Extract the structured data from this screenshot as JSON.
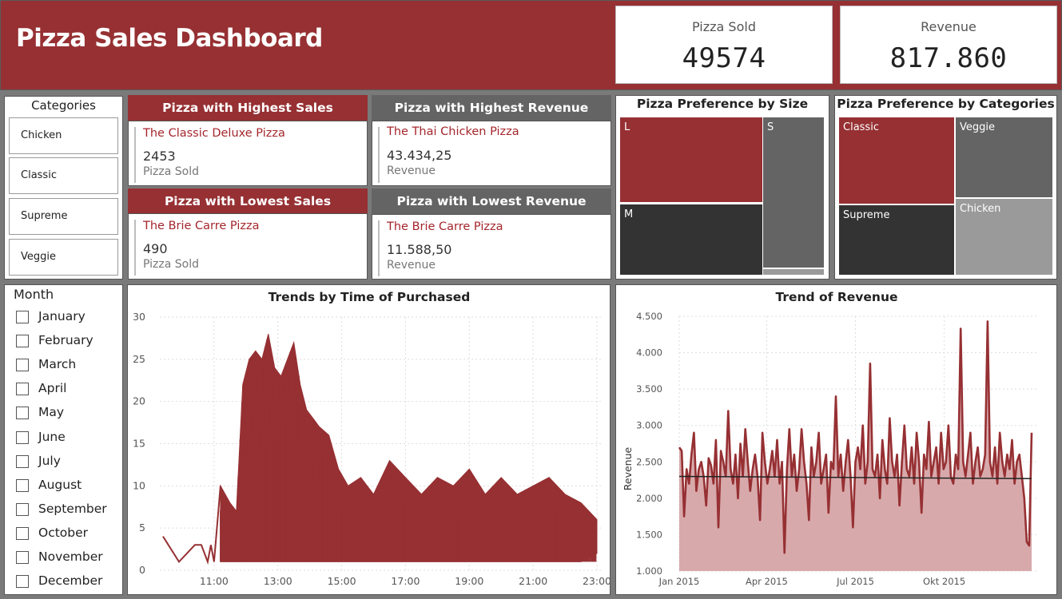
{
  "header": {
    "title": "Pizza Sales Dashboard"
  },
  "kpis": {
    "pizza_sold": {
      "label": "Pizza Sold",
      "value": "49574"
    },
    "revenue": {
      "label": "Revenue",
      "value": "817.860"
    }
  },
  "categories_slicer": {
    "title": "Categories",
    "items": [
      "Chicken",
      "Classic",
      "Supreme",
      "Veggie"
    ]
  },
  "cards": {
    "highest_sales": {
      "title": "Pizza with Highest Sales",
      "name": "The Classic Deluxe Pizza",
      "value": "2453",
      "sub": "Pizza Sold"
    },
    "highest_revenue": {
      "title": "Pizza with Highest Revenue",
      "name": "The Thai Chicken Pizza",
      "value": "43.434,25",
      "sub": "Revenue"
    },
    "lowest_sales": {
      "title": "Pizza with Lowest Sales",
      "name": "The Brie Carre Pizza",
      "value": "490",
      "sub": "Pizza Sold"
    },
    "lowest_revenue": {
      "title": "Pizza with Lowest Revenue",
      "name": "The Brie Carre Pizza",
      "value": "11.588,50",
      "sub": "Revenue"
    }
  },
  "size_treemap": {
    "title": "Pizza Preference by Size",
    "tiles": {
      "L": "L",
      "M": "M",
      "S": "S"
    }
  },
  "category_treemap": {
    "title": "Pizza Preference by Categories",
    "tiles": {
      "classic": "Classic",
      "veggie": "Veggie",
      "supreme": "Supreme",
      "chicken": "Chicken"
    }
  },
  "month_slicer": {
    "title": "Month",
    "items": [
      "January",
      "February",
      "March",
      "April",
      "May",
      "June",
      "July",
      "August",
      "September",
      "October",
      "November",
      "December"
    ]
  },
  "colors": {
    "brand_red": "#963033",
    "dark": "#333333",
    "gray": "#646464",
    "light_gray": "#9a9a9a",
    "area_fill": "#d8a9ab"
  },
  "chart_data": [
    {
      "id": "time_trend",
      "type": "line",
      "title": "Trends by Time of Purchased",
      "xlabel": "",
      "ylabel": "",
      "x_ticks": [
        "11:00",
        "13:00",
        "15:00",
        "17:00",
        "19:00",
        "21:00",
        "23:00"
      ],
      "x_range_hours": [
        9.3,
        23.2
      ],
      "ylim": [
        0,
        30
      ],
      "y_ticks": [
        0,
        5,
        10,
        15,
        20,
        25,
        30
      ],
      "envelope": {
        "hours": [
          9.4,
          9.9,
          10.4,
          10.6,
          10.8,
          10.9,
          11.0,
          11.2,
          11.5,
          11.7,
          11.9,
          12.1,
          12.3,
          12.5,
          12.7,
          12.9,
          13.1,
          13.3,
          13.5,
          13.7,
          13.9,
          14.1,
          14.3,
          14.6,
          14.9,
          15.2,
          15.6,
          16.0,
          16.5,
          17.0,
          17.5,
          18.0,
          18.5,
          19.0,
          19.5,
          20.0,
          20.5,
          21.0,
          21.5,
          22.0,
          22.5,
          23.0
        ],
        "max": [
          4,
          1,
          3,
          3,
          1,
          3,
          1,
          10,
          8,
          7,
          22,
          25,
          26,
          25,
          28,
          24,
          23,
          25,
          27,
          22,
          19,
          18,
          17,
          16,
          12,
          10,
          11,
          9,
          13,
          11,
          9,
          11,
          10,
          12,
          9,
          11,
          9,
          10,
          11,
          9,
          8,
          6
        ],
        "min": [
          4,
          1,
          3,
          3,
          1,
          3,
          1,
          1,
          1,
          1,
          1,
          1,
          1,
          1,
          1,
          1,
          1,
          1,
          1,
          1,
          1,
          1,
          1,
          1,
          1,
          1,
          1,
          1,
          1,
          1,
          1,
          1,
          1,
          1,
          1,
          1,
          1,
          1,
          1,
          1,
          1,
          2
        ]
      }
    },
    {
      "id": "revenue_trend",
      "type": "area",
      "title": "Trend of Revenue",
      "xlabel": "",
      "ylabel": "Revenue",
      "x_ticks": [
        "Jan 2015",
        "Apr 2015",
        "Jul 2015",
        "Okt 2015"
      ],
      "ylim": [
        1000,
        4500
      ],
      "y_ticks": [
        "1.000",
        "1.500",
        "2.000",
        "2.500",
        "3.000",
        "3.500",
        "4.000",
        "4.500"
      ],
      "trendline": {
        "start": 2300,
        "end": 2270
      },
      "series": [
        {
          "values": [
            2700,
            2650,
            1750,
            2400,
            2200,
            2600,
            2900,
            2100,
            2400,
            2500,
            2300,
            1900,
            2550,
            2450,
            2200,
            2800,
            1600,
            2650,
            2500,
            2300,
            3200,
            2400,
            2200,
            2600,
            2000,
            2750,
            2300,
            2950,
            2500,
            2100,
            2400,
            2600,
            2300,
            1700,
            2900,
            2500,
            2200,
            2400,
            2650,
            2300,
            2800,
            2200,
            2500,
            1250,
            2400,
            2950,
            2300,
            2600,
            2100,
            2400,
            2950,
            2500,
            2200,
            1700,
            2700,
            2300,
            2500,
            2900,
            2200,
            2400,
            2600,
            1800,
            2500,
            2400,
            3400,
            2300,
            2600,
            2100,
            2500,
            2800,
            2300,
            1600,
            2500,
            2700,
            2400,
            3000,
            2200,
            2500,
            3850,
            2400,
            2300,
            2600,
            2000,
            2800,
            2400,
            2200,
            3100,
            2500,
            2300,
            2600,
            1900,
            2500,
            3000,
            2400,
            2300,
            2700,
            2200,
            2900,
            2500,
            1800,
            2600,
            2400,
            3050,
            2300,
            2500,
            2700,
            2200,
            2900,
            2400,
            2500,
            3000,
            2300,
            2200,
            2600,
            2400,
            4330,
            2500,
            2300,
            2600,
            2900,
            2200,
            2500,
            2700,
            2300,
            2400,
            2600,
            4430,
            2500,
            2300,
            2700,
            2200,
            2900,
            2500,
            2300,
            2600,
            2400,
            2800,
            2200,
            2500,
            2600,
            2300,
            2000,
            1400,
            1350,
            2900
          ]
        }
      ]
    }
  ]
}
